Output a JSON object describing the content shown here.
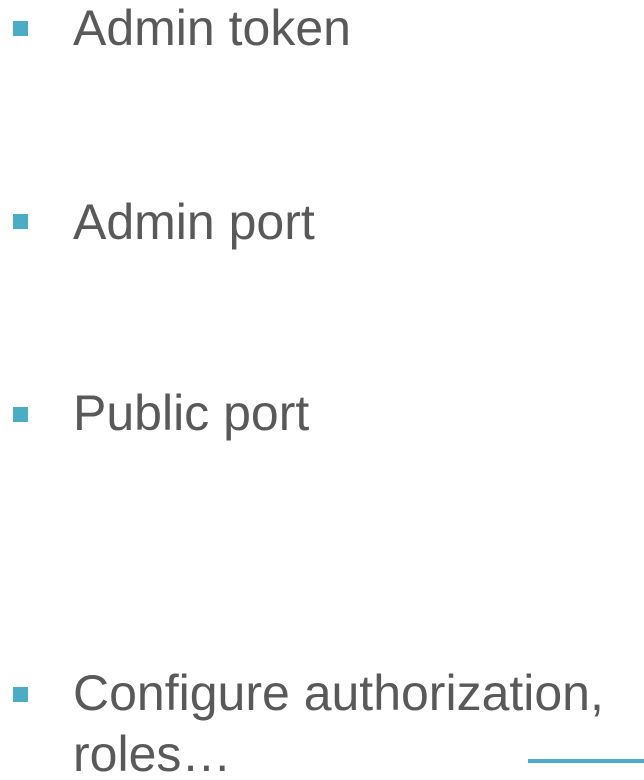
{
  "colors": {
    "bullet": "#4bacc6",
    "text": "#595959",
    "accent_line": "#4bacc6"
  },
  "bullets": [
    {
      "text": "Admin token"
    },
    {
      "text": "Admin port"
    },
    {
      "text": "Public port"
    },
    {
      "text_line_1": "Configure authorization,",
      "text_line_2": "roles…"
    }
  ]
}
